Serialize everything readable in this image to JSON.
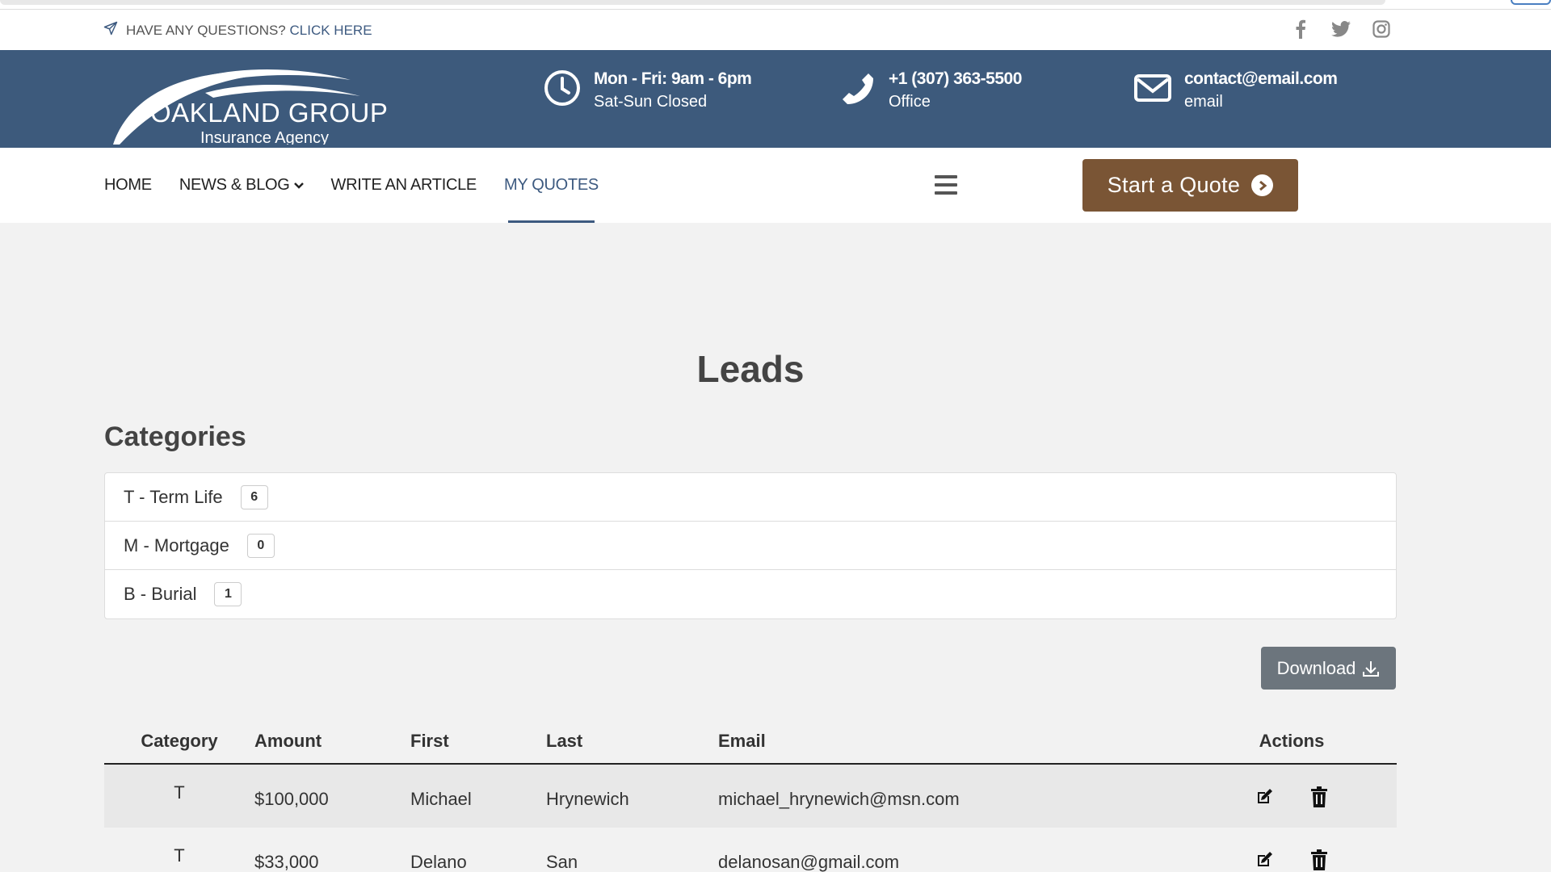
{
  "topbar": {
    "question_text": "HAVE ANY QUESTIONS?",
    "question_link": "CLICK HERE",
    "social": [
      "facebook-icon",
      "twitter-icon",
      "instagram-icon"
    ]
  },
  "header": {
    "logo_name": "OAKLAND GROUP",
    "logo_sub": "Insurance Agency",
    "hours": {
      "line1": "Mon - Fri: 9am - 6pm",
      "line2": "Sat-Sun Closed"
    },
    "phone": {
      "line1": "+1 (307) 363-5500",
      "line2": "Office"
    },
    "email": {
      "line1": "contact@email.com",
      "line2": "email"
    }
  },
  "nav": {
    "items": [
      "HOME",
      "NEWS & BLOG",
      "WRITE AN ARTICLE",
      "MY QUOTES"
    ],
    "active": "MY QUOTES",
    "quote_button": "Start a Quote"
  },
  "main": {
    "title": "Leads",
    "categories_title": "Categories",
    "categories": [
      {
        "label": "T - Term Life",
        "count": "6"
      },
      {
        "label": "M - Mortgage",
        "count": "0"
      },
      {
        "label": "B - Burial",
        "count": "1"
      }
    ],
    "download_label": "Download"
  },
  "table": {
    "headers": [
      "Category",
      "Amount",
      "First",
      "Last",
      "Email",
      "Actions"
    ],
    "rows": [
      {
        "category": "T",
        "amount": "$100,000",
        "first": "Michael",
        "last": "Hrynewich",
        "email": "michael_hrynewich@msn.com"
      },
      {
        "category": "T",
        "amount": "$33,000",
        "first": "Delano",
        "last": "San",
        "email": "delanosan@gmail.com"
      }
    ]
  },
  "colors": {
    "header_bg": "#3d5a7c",
    "accent": "#3d5a80",
    "quote_button": "#7a5535",
    "download_button": "#6c757d"
  }
}
